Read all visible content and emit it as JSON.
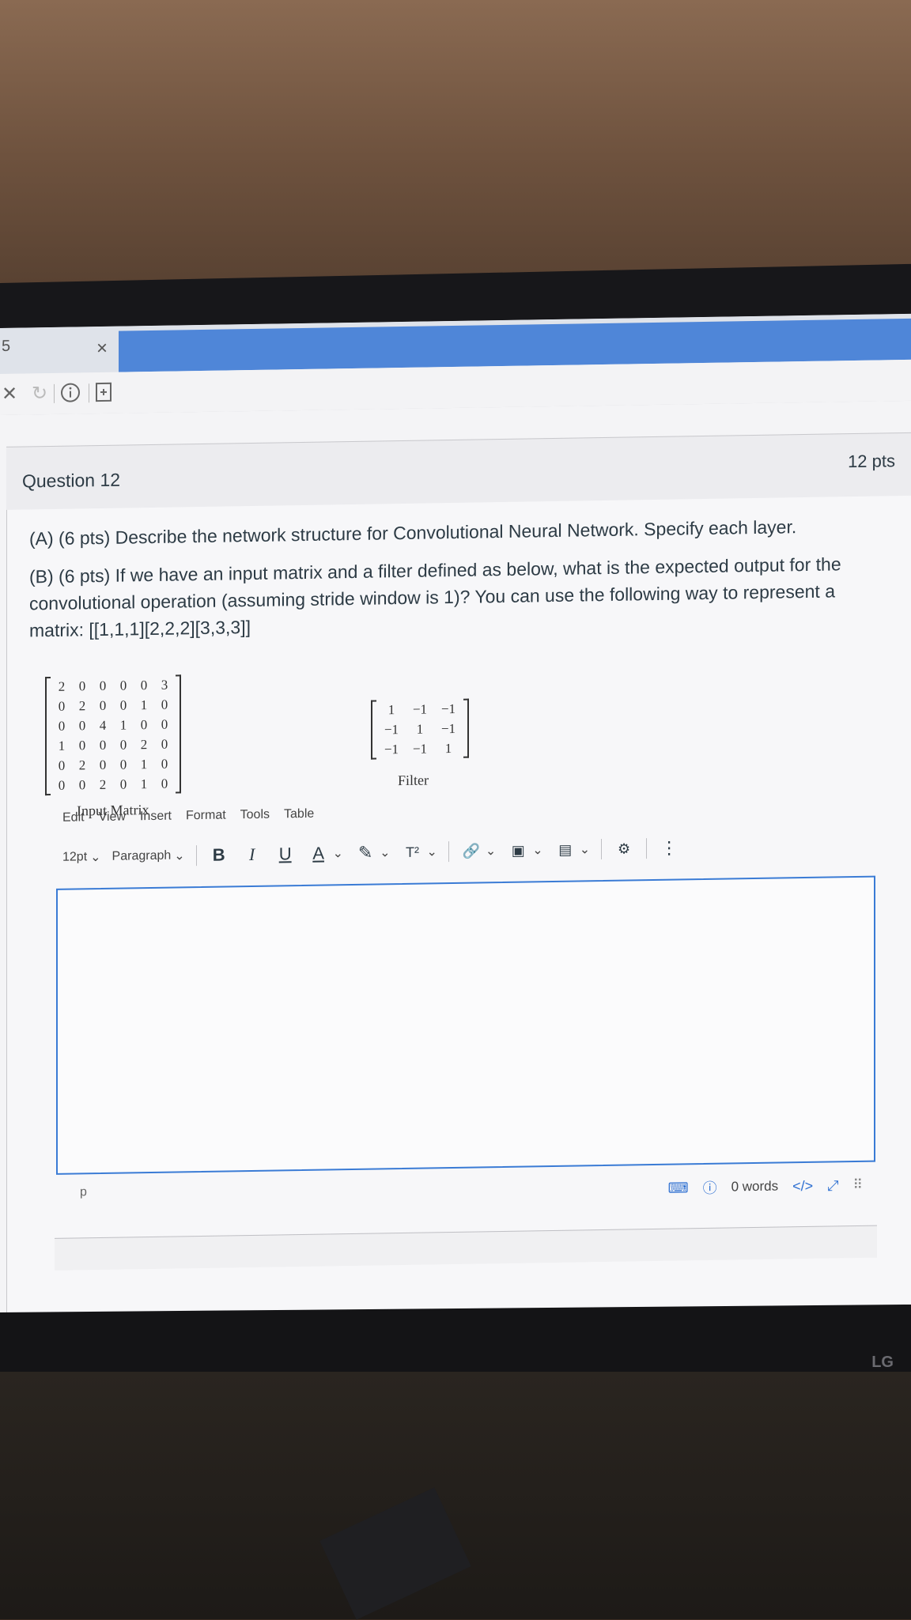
{
  "question": {
    "title": "Question 12",
    "points": "12 pts",
    "part_a": "(A) (6 pts) Describe the network structure for Convolutional Neural Network. Specify each layer.",
    "part_b": "(B) (6 pts) If we have an input matrix and a filter defined as below, what is the expected output for the convolutional operation (assuming stride window is 1)? You can use the following way to represent a matrix: [[1,1,1][2,2,2][3,3,3]]"
  },
  "input_matrix": {
    "caption": "Input Matrix",
    "rows": [
      [
        "2",
        "0",
        "0",
        "0",
        "0",
        "3"
      ],
      [
        "0",
        "2",
        "0",
        "0",
        "1",
        "0"
      ],
      [
        "0",
        "0",
        "4",
        "1",
        "0",
        "0"
      ],
      [
        "1",
        "0",
        "0",
        "0",
        "2",
        "0"
      ],
      [
        "0",
        "2",
        "0",
        "0",
        "1",
        "0"
      ],
      [
        "0",
        "0",
        "2",
        "0",
        "1",
        "0"
      ]
    ]
  },
  "filter_matrix": {
    "caption": "Filter",
    "rows": [
      [
        "1",
        "−1",
        "−1"
      ],
      [
        "−1",
        "1",
        "−1"
      ],
      [
        "−1",
        "−1",
        "1"
      ]
    ]
  },
  "editor": {
    "menu": [
      "Edit",
      "View",
      "Insert",
      "Format",
      "Tools",
      "Table"
    ],
    "font_size": "12pt",
    "block_format": "Paragraph",
    "bold": "B",
    "italic": "I",
    "underline": "U",
    "text_color": "A",
    "superscript": "T²",
    "element_path": "p",
    "word_count": "0 words",
    "html_toggle": "</>"
  },
  "browser": {
    "tab_close": "×"
  },
  "monitor": {
    "brand": "LG"
  },
  "colors": {
    "accent": "#3a7bd5",
    "text": "#2d3b45",
    "tab_active": "#4f86d8"
  }
}
